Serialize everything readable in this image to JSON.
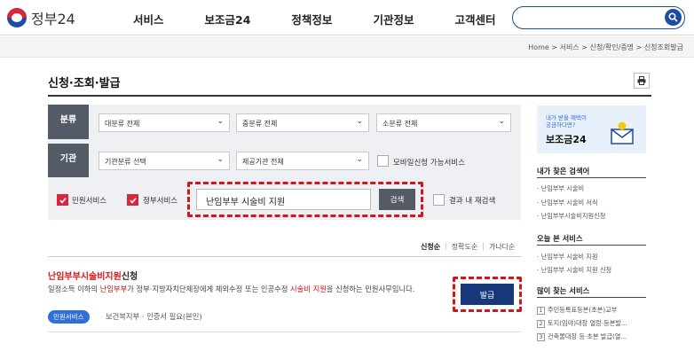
{
  "header": {
    "logo_text": "정부24",
    "nav": [
      "서비스",
      "보조금24",
      "정책정보",
      "기관정보",
      "고객센터"
    ],
    "search_placeholder": ""
  },
  "breadcrumb": "Home > 서비스 > 신청/확인/증명 > 신청조회발급",
  "page_title": "신청·조회·발급",
  "filters": {
    "category_label": "분류",
    "agency_label": "기관",
    "major_category": "대분류 전체",
    "mid_category": "중분류 전체",
    "minor_category": "소분류 전체",
    "agency_select": "기관분류 선택",
    "provider_select": "제공기관 전체",
    "mobile_label": "모바일신청 가능서비스",
    "civil_label": "민원서비스",
    "gov_label": "정부서비스",
    "query_value": "난임부부 시술비 지원",
    "search_button": "검색",
    "research_label": "결과 내 재검색"
  },
  "sort": {
    "options": [
      "신청순",
      "정확도순",
      "가나다순"
    ]
  },
  "result": {
    "title_highlight": "난임부부시술비지원",
    "title_rest": "신청",
    "desc_parts": [
      "일정소득 이하의 ",
      "난임부부",
      "가 정부·지방자치단체장에게 체외수정 또는 인공수정 ",
      "시술비 지원",
      "을 신청하는 민원사무입니다."
    ],
    "tag": "민원서비스",
    "meta": "보건복지부 · 인증서 필요(본인)",
    "issue_button": "발급"
  },
  "sidebar": {
    "banner_sub1": "내가 받을 혜택이",
    "banner_sub2": "궁금하다면?",
    "banner_title": "보조금24",
    "my_search_title": "내가 찾은 검색어",
    "my_search_items": [
      "난임부부 시술비",
      "난임부부 시술비 서식",
      "난임부부시술비지원신청"
    ],
    "today_title": "오늘 본 서비스",
    "today_items": [
      "난임부부 시술비 지원",
      "난임부부 시술비 지원 신청"
    ],
    "popular_title": "많이 찾는 서비스",
    "popular_items": [
      {
        "num": "1",
        "label": "주민등록표등본(초본)교부"
      },
      {
        "num": "2",
        "label": "토지(임야)대장 열람·등본발..."
      },
      {
        "num": "3",
        "label": "건축물대장 등·초본 발급(열..."
      }
    ]
  },
  "colors": {
    "brand_blue": "#1c4da1",
    "highlight_red": "#d9131a",
    "filter_label_bg": "#555b66",
    "issue_button_bg": "#16377a"
  }
}
